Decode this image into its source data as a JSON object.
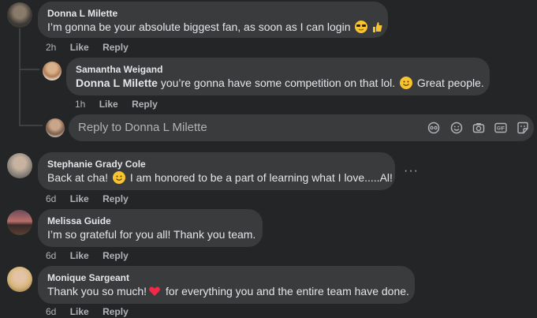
{
  "comments": [
    {
      "author": "Donna L Milette",
      "text": "I’m gonna be your absolute biggest fan, as soon as I can login",
      "time": "2h",
      "like": "Like",
      "reply": "Reply"
    },
    {
      "author": "Samantha Weigand",
      "mention": "Donna L Milette",
      "text_before_emoji": " you’re gonna have some competition on that lol.",
      "text_after_emoji": " Great people.",
      "time": "1h",
      "like": "Like",
      "reply": "Reply"
    },
    {
      "author": "Stephanie Grady Cole",
      "text_before_emoji": "Back at cha!",
      "text_after_emoji": " I am honored to be a part of learning what I love.....Al!",
      "time": "6d",
      "like": "Like",
      "reply": "Reply"
    },
    {
      "author": "Melissa Guide",
      "text": "I’m so grateful for you all! Thank you team.",
      "time": "6d",
      "like": "Like",
      "reply": "Reply"
    },
    {
      "author": "Monique Sargeant",
      "text_before_emoji": "Thank you so much!",
      "text_after_emoji": " for everything you and the entire team have done.",
      "time": "6d",
      "like": "Like",
      "reply": "Reply"
    }
  ],
  "reply_box": {
    "placeholder": "Reply to Donna L Milette",
    "tools": [
      "avatar-sticker-icon",
      "emoji-icon",
      "camera-icon",
      "gif-icon",
      "sticker-icon"
    ]
  },
  "more_options": "···",
  "colors": {
    "background": "#242526",
    "bubble": "#3a3b3c",
    "meta": "#b0b3b8"
  }
}
